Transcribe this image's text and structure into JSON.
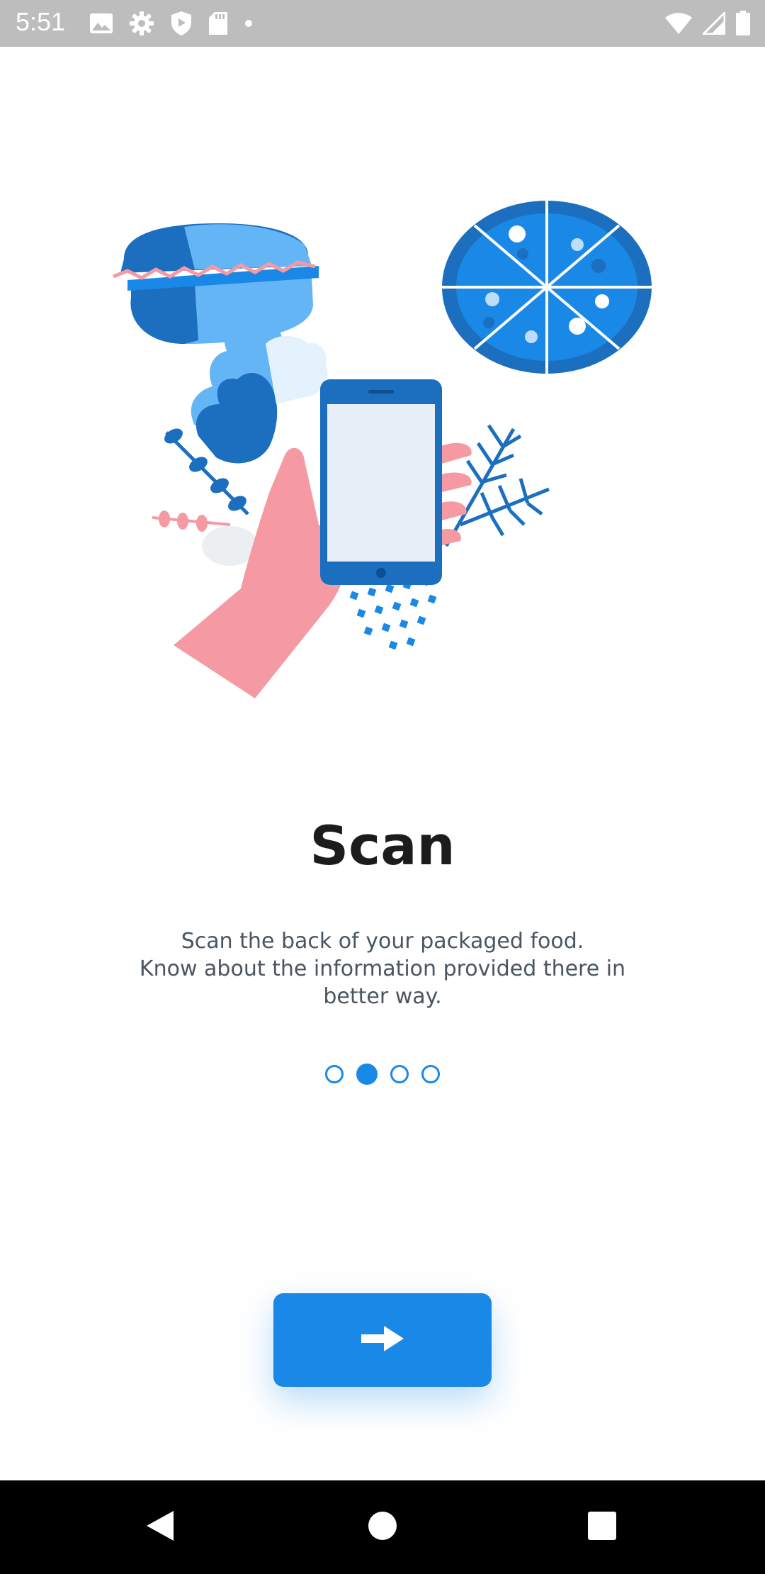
{
  "status_bar": {
    "time": "5:51",
    "left_icons": [
      "image-icon",
      "gear-icon",
      "shield-icon",
      "sd-card-icon",
      "dot-icon"
    ],
    "right_icons": [
      "wifi-icon",
      "signal-icon",
      "battery-icon"
    ]
  },
  "onboarding": {
    "title": "Scan",
    "description_lines": [
      "Scan the back of your packaged food.",
      "Know about the information provided there in",
      "better way."
    ],
    "page_indicator": {
      "total": 4,
      "active_index": 1
    },
    "next_button_icon": "arrow-right-icon"
  },
  "colors": {
    "accent": "#1a88e6",
    "title": "#1c1c1c",
    "body_text": "#4a5560",
    "status_bar": "#bdbdbd",
    "nav_bar": "#000000",
    "illustration_pink": "#f59aa3",
    "illustration_dark_blue": "#1c6fbf",
    "illustration_light_blue": "#64b5f6"
  },
  "nav_bar": {
    "buttons": [
      "back-icon",
      "home-icon",
      "recents-icon"
    ]
  }
}
